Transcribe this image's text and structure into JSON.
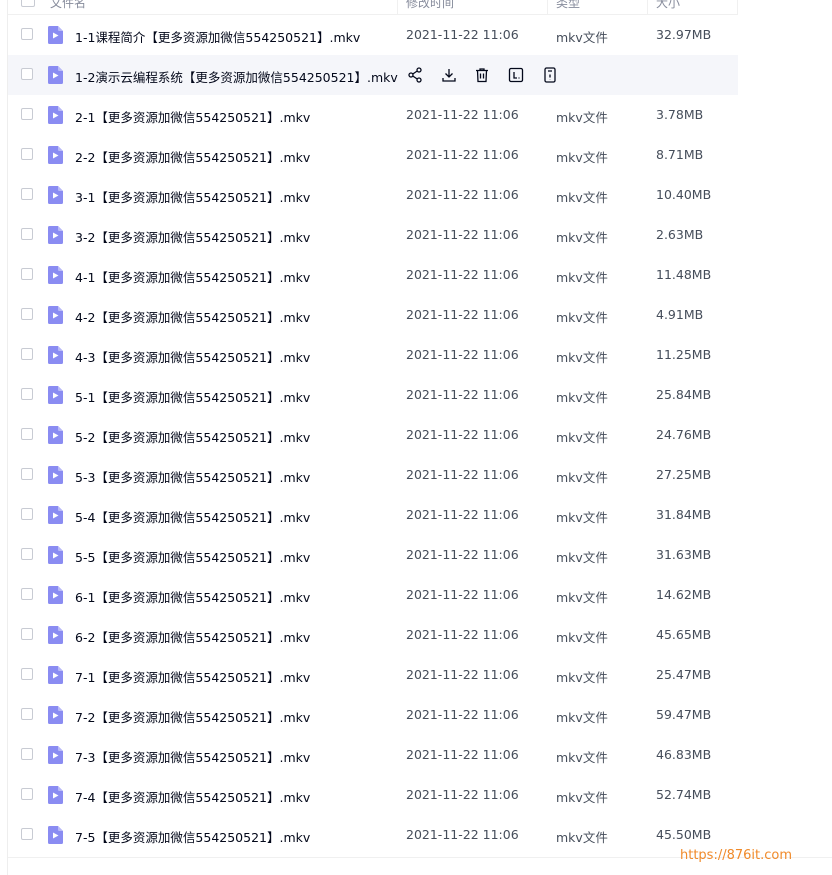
{
  "header": {
    "col_name": "文件名",
    "col_modified": "修改时间",
    "col_type": "类型",
    "col_size": "大小"
  },
  "actions": {
    "share": "share-icon",
    "download": "download-icon",
    "delete": "trash-icon",
    "text": "text-icon",
    "more": "more-icon"
  },
  "files": [
    {
      "name": "1-1课程简介【更多资源加微信554250521】.mkv",
      "date": "2021-11-22 11:06",
      "type": "mkv文件",
      "size": "32.97MB"
    },
    {
      "name": "1-2演示云编程系统【更多资源加微信554250521】.mkv",
      "date": "",
      "type": "",
      "size": ""
    },
    {
      "name": "2-1【更多资源加微信554250521】.mkv",
      "date": "2021-11-22 11:06",
      "type": "mkv文件",
      "size": "3.78MB"
    },
    {
      "name": "2-2【更多资源加微信554250521】.mkv",
      "date": "2021-11-22 11:06",
      "type": "mkv文件",
      "size": "8.71MB"
    },
    {
      "name": "3-1【更多资源加微信554250521】.mkv",
      "date": "2021-11-22 11:06",
      "type": "mkv文件",
      "size": "10.40MB"
    },
    {
      "name": "3-2【更多资源加微信554250521】.mkv",
      "date": "2021-11-22 11:06",
      "type": "mkv文件",
      "size": "2.63MB"
    },
    {
      "name": "4-1【更多资源加微信554250521】.mkv",
      "date": "2021-11-22 11:06",
      "type": "mkv文件",
      "size": "11.48MB"
    },
    {
      "name": "4-2【更多资源加微信554250521】.mkv",
      "date": "2021-11-22 11:06",
      "type": "mkv文件",
      "size": "4.91MB"
    },
    {
      "name": "4-3【更多资源加微信554250521】.mkv",
      "date": "2021-11-22 11:06",
      "type": "mkv文件",
      "size": "11.25MB"
    },
    {
      "name": "5-1【更多资源加微信554250521】.mkv",
      "date": "2021-11-22 11:06",
      "type": "mkv文件",
      "size": "25.84MB"
    },
    {
      "name": "5-2【更多资源加微信554250521】.mkv",
      "date": "2021-11-22 11:06",
      "type": "mkv文件",
      "size": "24.76MB"
    },
    {
      "name": "5-3【更多资源加微信554250521】.mkv",
      "date": "2021-11-22 11:06",
      "type": "mkv文件",
      "size": "27.25MB"
    },
    {
      "name": "5-4【更多资源加微信554250521】.mkv",
      "date": "2021-11-22 11:06",
      "type": "mkv文件",
      "size": "31.84MB"
    },
    {
      "name": "5-5【更多资源加微信554250521】.mkv",
      "date": "2021-11-22 11:06",
      "type": "mkv文件",
      "size": "31.63MB"
    },
    {
      "name": "6-1【更多资源加微信554250521】.mkv",
      "date": "2021-11-22 11:06",
      "type": "mkv文件",
      "size": "14.62MB"
    },
    {
      "name": "6-2【更多资源加微信554250521】.mkv",
      "date": "2021-11-22 11:06",
      "type": "mkv文件",
      "size": "45.65MB"
    },
    {
      "name": "7-1【更多资源加微信554250521】.mkv",
      "date": "2021-11-22 11:06",
      "type": "mkv文件",
      "size": "25.47MB"
    },
    {
      "name": "7-2【更多资源加微信554250521】.mkv",
      "date": "2021-11-22 11:06",
      "type": "mkv文件",
      "size": "59.47MB"
    },
    {
      "name": "7-3【更多资源加微信554250521】.mkv",
      "date": "2021-11-22 11:06",
      "type": "mkv文件",
      "size": "46.83MB"
    },
    {
      "name": "7-4【更多资源加微信554250521】.mkv",
      "date": "2021-11-22 11:06",
      "type": "mkv文件",
      "size": "52.74MB"
    },
    {
      "name": "7-5【更多资源加微信554250521】.mkv",
      "date": "2021-11-22 11:06",
      "type": "mkv文件",
      "size": "45.50MB"
    }
  ],
  "watermark": "https://876it.com",
  "colors": {
    "accent": "#06a7ff",
    "video_icon": "#8a8cf2",
    "watermark": "#f08a2a",
    "hover_row": "#f5f6fa"
  }
}
